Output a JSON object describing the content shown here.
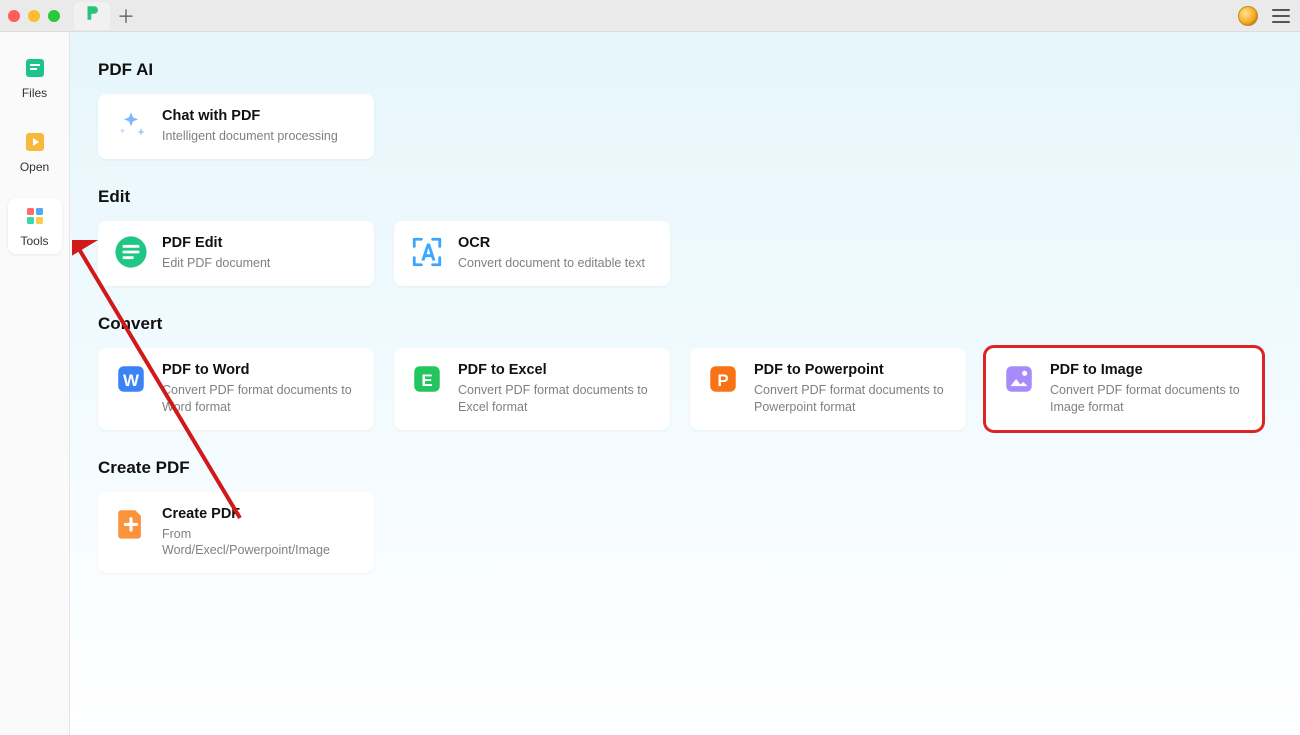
{
  "titlebar": {},
  "sidebar": {
    "items": [
      {
        "label": "Files"
      },
      {
        "label": "Open"
      },
      {
        "label": "Tools"
      }
    ]
  },
  "sections": {
    "pdf_ai": {
      "title": "PDF AI",
      "cards": [
        {
          "title": "Chat with PDF",
          "desc": "Intelligent document processing"
        }
      ]
    },
    "edit": {
      "title": "Edit",
      "cards": [
        {
          "title": "PDF Edit",
          "desc": "Edit PDF document"
        },
        {
          "title": "OCR",
          "desc": "Convert document to editable text"
        }
      ]
    },
    "convert": {
      "title": "Convert",
      "cards": [
        {
          "title": "PDF to Word",
          "desc": "Convert PDF format documents to Word format"
        },
        {
          "title": "PDF to Excel",
          "desc": "Convert PDF format documents to Excel format"
        },
        {
          "title": "PDF to Powerpoint",
          "desc": "Convert PDF format documents to Powerpoint format"
        },
        {
          "title": "PDF to Image",
          "desc": "Convert PDF format documents to Image format"
        }
      ]
    },
    "create": {
      "title": "Create PDF",
      "cards": [
        {
          "title": "Create PDF",
          "desc": "From Word/Execl/Powerpoint/Image"
        }
      ]
    }
  }
}
